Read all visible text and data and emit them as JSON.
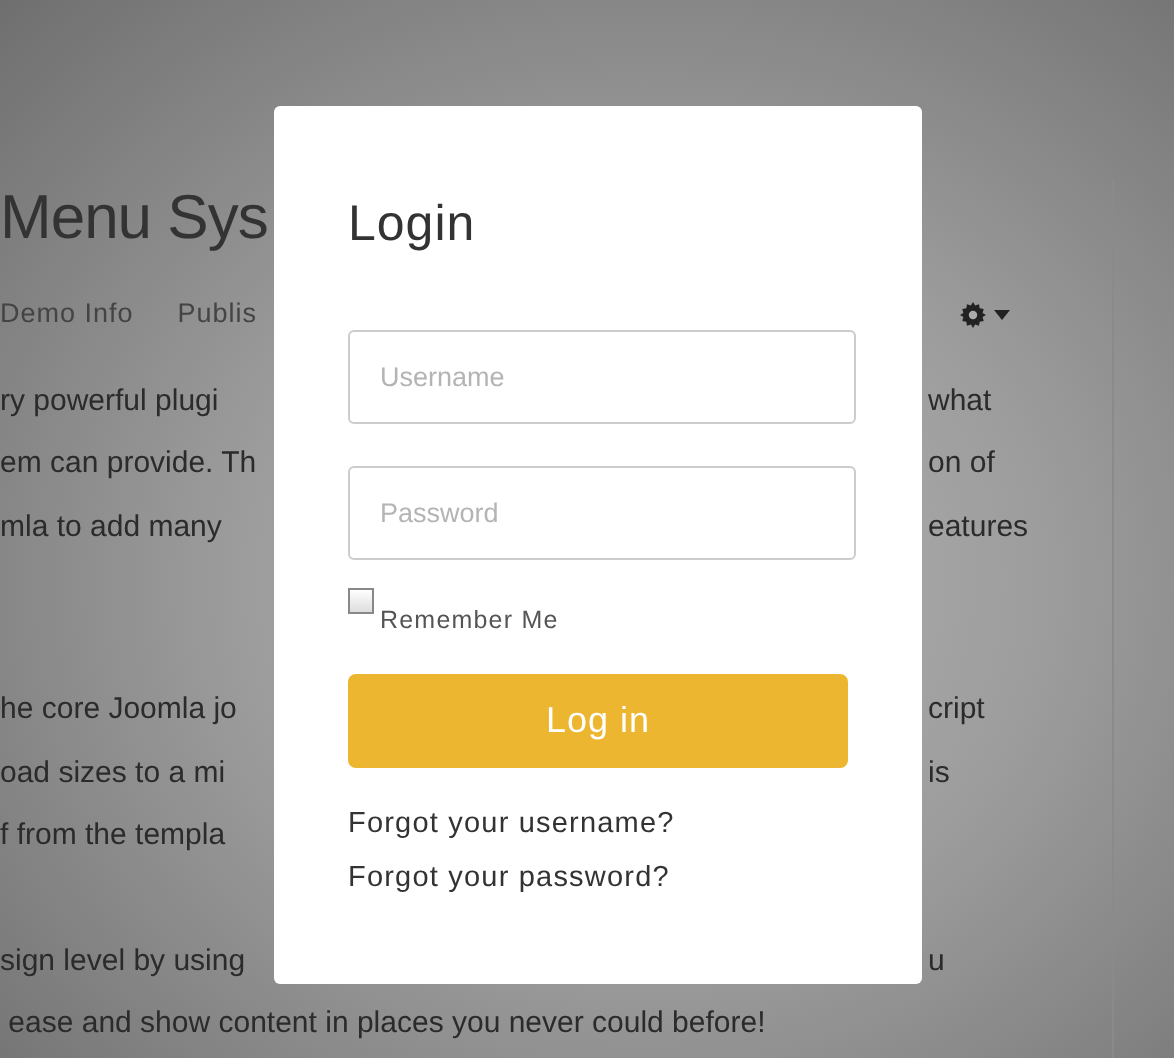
{
  "page": {
    "title": "Menu Sys",
    "nav": [
      {
        "label": "Demo Info"
      },
      {
        "label": "Publis"
      }
    ],
    "paragraphs": [
      {
        "lines": [
          {
            "left": "ry powerful plugi",
            "right": "what"
          },
          {
            "left": "em can provide. Th",
            "right": "on of"
          },
          {
            "left": "mla to add many",
            "right": "eatures"
          }
        ]
      },
      {
        "lines": [
          {
            "left": "he core Joomla jo",
            "right": "cript"
          },
          {
            "left": "oad sizes to a mi",
            "right": "is"
          },
          {
            "left": "f from the templa"
          }
        ]
      },
      {
        "lines": [
          {
            "left": "sign level by using",
            "right": "u"
          },
          {
            "left": " ease and show content in places you never could before!"
          }
        ]
      }
    ]
  },
  "modal": {
    "title": "Login",
    "fields": [
      {
        "placeholder": "Username"
      },
      {
        "placeholder": "Password"
      }
    ],
    "remember": {
      "label": "Remember Me",
      "checked": false
    },
    "button": "Log in",
    "links": [
      "Forgot your username?",
      "Forgot your password?"
    ]
  }
}
